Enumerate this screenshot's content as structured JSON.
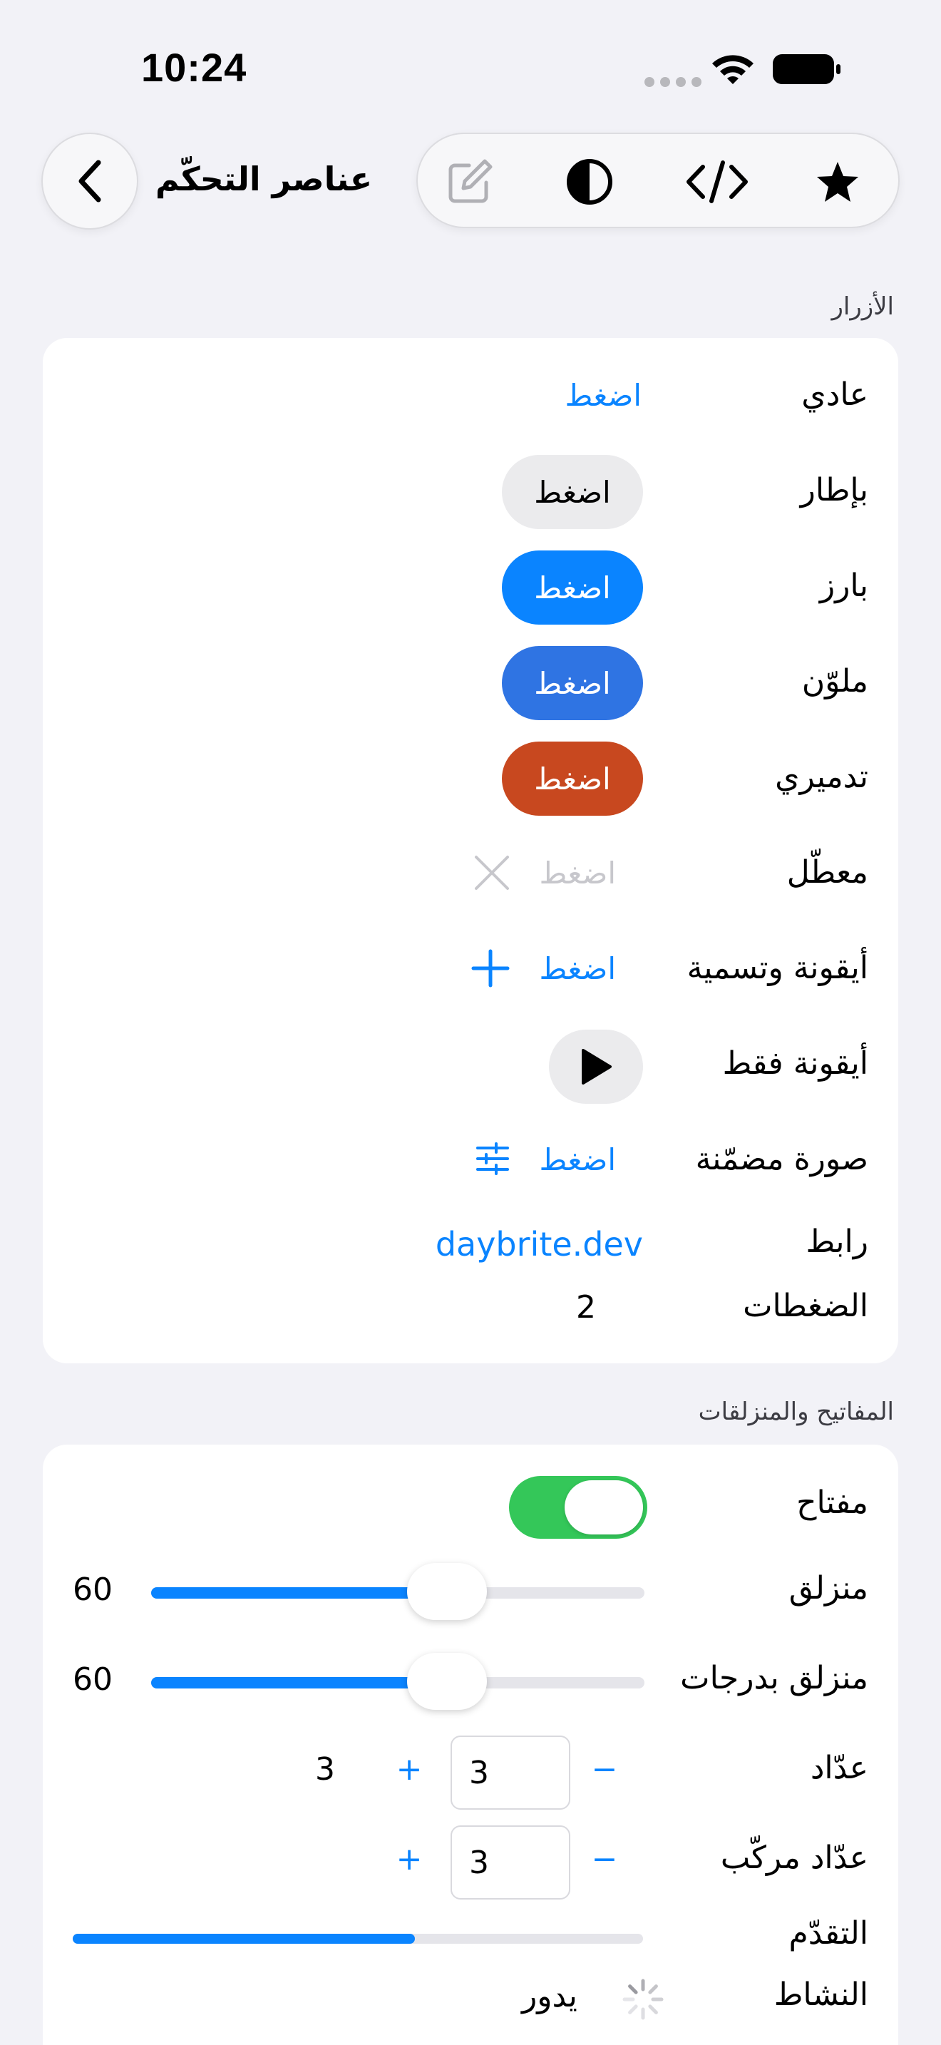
{
  "status_bar": {
    "time": "10:24"
  },
  "nav": {
    "title": "عناصر التحكّم",
    "toolbar_icons": [
      "compose-icon",
      "contrast-icon",
      "code-icon",
      "star-icon"
    ]
  },
  "buttons_section": {
    "header": "الأزرار",
    "rows": [
      {
        "label": "عادي",
        "button": "اضغط"
      },
      {
        "label": "بإطار",
        "button": "اضغط"
      },
      {
        "label": "بارز",
        "button": "اضغط"
      },
      {
        "label": "ملوّن",
        "button": "اضغط"
      },
      {
        "label": "تدميري",
        "button": "اضغط"
      },
      {
        "label": "معطّل",
        "button": "اضغط"
      },
      {
        "label": "أيقونة وتسمية",
        "button": "اضغط"
      },
      {
        "label": "أيقونة فقط"
      },
      {
        "label": "صورة مضمّنة",
        "button": "اضغط"
      },
      {
        "label": "رابط",
        "link": "daybrite.dev"
      },
      {
        "label": "الضغطات",
        "value": "2"
      }
    ]
  },
  "controls_section": {
    "header": "المفاتيح والمنزلقات",
    "toggle": {
      "label": "مفتاح",
      "on": true
    },
    "slider": {
      "label": "منزلق",
      "value": "60",
      "fraction": 0.6
    },
    "stepped_slider": {
      "label": "منزلق بدرجات",
      "value": "60",
      "fraction": 0.6
    },
    "stepper": {
      "label": "عدّاد",
      "minus": "−",
      "plus": "+",
      "field": "3",
      "value": "3"
    },
    "compound_stepper": {
      "label": "عدّاد مركّب",
      "minus": "−",
      "plus": "+",
      "field": "3"
    },
    "progress": {
      "label": "التقدّم",
      "fraction": 0.6
    },
    "activity": {
      "label": "النشاط",
      "text": "يدور"
    }
  },
  "colors": {
    "accent": "#0a84ff",
    "prominent": "#0a84ff",
    "tinted": "#2f74e3",
    "destructive": "#c8481f",
    "toggle_on": "#34c759"
  }
}
